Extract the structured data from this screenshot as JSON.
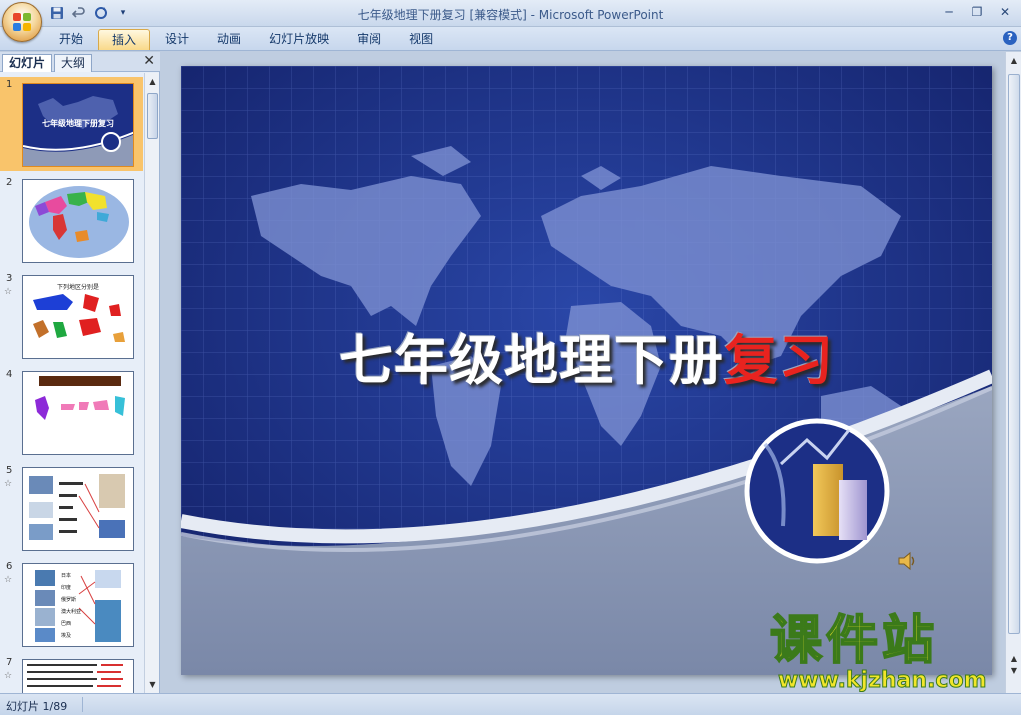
{
  "window": {
    "title": "七年级地理下册复习 [兼容模式] - Microsoft PowerPoint",
    "controls": [
      "─",
      "❐",
      "✕"
    ]
  },
  "quick_access": {
    "save_icon": "save-icon",
    "undo_icon": "undo-icon",
    "redo_icon": "redo-icon"
  },
  "ribbon": {
    "tabs": [
      "开始",
      "插入",
      "设计",
      "动画",
      "幻灯片放映",
      "审阅",
      "视图"
    ],
    "active_tab": "插入",
    "help": "?"
  },
  "left_pane": {
    "tab_slides": "幻灯片",
    "tab_outline": "大纲",
    "close": "✕",
    "thumbnails": [
      {
        "num": "1",
        "star": false,
        "caption": "七年级地理下册复习"
      },
      {
        "num": "2",
        "star": false
      },
      {
        "num": "3",
        "star": true,
        "caption": "下列地区分别是"
      },
      {
        "num": "4",
        "star": false
      },
      {
        "num": "5",
        "star": true
      },
      {
        "num": "6",
        "star": true,
        "labels": [
          "日本",
          "印度",
          "俄罗斯",
          "澳大利亚",
          "巴西",
          "埃及"
        ]
      },
      {
        "num": "7",
        "star": true
      }
    ]
  },
  "slide": {
    "title_main": "七年级地理下册",
    "title_highlight": "复习"
  },
  "watermark": {
    "brand": "课件站",
    "url": "www.kjzhan.com"
  },
  "status": {
    "slide_indicator": "幻灯片 1/89"
  },
  "colors": {
    "slide_bg": "#1c2f86",
    "title_red": "#e8231f",
    "selected_thumb": "#f9c46b",
    "watermark": "#f2e62a"
  }
}
